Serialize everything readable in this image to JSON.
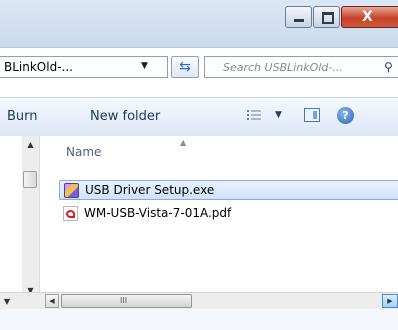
{
  "window": {
    "controls": {
      "minimize_icon": "minimize-icon",
      "maximize_icon": "maximize-icon",
      "close_label": "X"
    }
  },
  "address_bar": {
    "path_text": "BLinkOld-...",
    "refresh_icon": "refresh-icon"
  },
  "search": {
    "placeholder": "Search USBLinkOld-..."
  },
  "toolbar": {
    "burn_label": "Burn",
    "new_folder_label": "New folder",
    "help_label": "?"
  },
  "file_list": {
    "column_header": "Name",
    "items": [
      {
        "name": "USB Driver Setup.exe",
        "icon": "installer-exe-icon",
        "selected": true
      },
      {
        "name": "WM-USB-Vista-7-01A.pdf",
        "icon": "pdf-file-icon",
        "selected": false
      }
    ]
  },
  "scrollbar": {
    "grip_label": "III"
  },
  "colors": {
    "chrome": "#c9d9ee",
    "selection": "#cfe3fb",
    "close_button": "#c5432a",
    "text": "#1e395b"
  }
}
